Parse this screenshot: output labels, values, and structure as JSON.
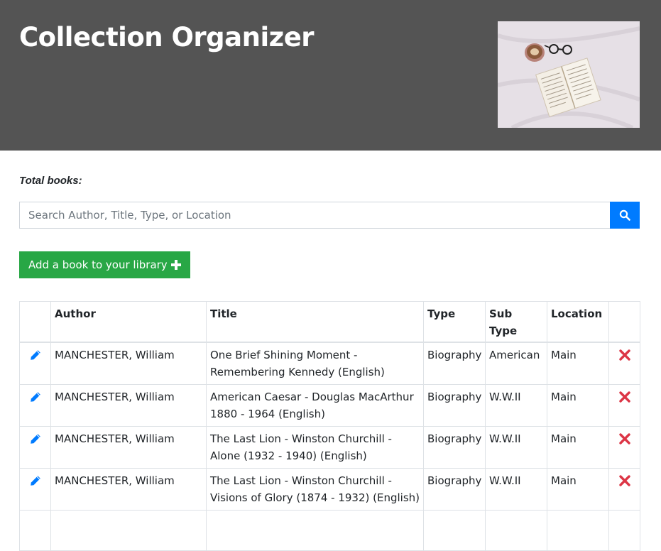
{
  "header": {
    "title": "Collection Organizer",
    "image_alt": "book-coffee-glasses-image"
  },
  "summary": {
    "total_label": "Total books:"
  },
  "search": {
    "placeholder": "Search Author, Title, Type, or Location",
    "value": ""
  },
  "actions": {
    "add_label": "Add a book to your library"
  },
  "table": {
    "headers": [
      "",
      "Author",
      "Title",
      "Type",
      "Sub Type",
      "Location",
      ""
    ],
    "rows": [
      {
        "author": "MANCHESTER, William",
        "title": "One Brief Shining Moment - Remembering Kennedy (English)",
        "type": "Biography",
        "subtype": "American",
        "location": "Main"
      },
      {
        "author": "MANCHESTER, William",
        "title": "American Caesar - Douglas MacArthur 1880 - 1964 (English)",
        "type": "Biography",
        "subtype": "W.W.II",
        "location": "Main"
      },
      {
        "author": "MANCHESTER, William",
        "title": "The Last Lion - Winston Churchill - Alone (1932 - 1940) (English)",
        "type": "Biography",
        "subtype": "W.W.II",
        "location": "Main"
      },
      {
        "author": "MANCHESTER, William",
        "title": "The Last Lion - Winston Churchill - Visions of Glory (1874 - 1932) (English)",
        "type": "Biography",
        "subtype": "W.W.II",
        "location": "Main"
      },
      {
        "author": "",
        "title": "",
        "type": "",
        "subtype": "",
        "location": ""
      }
    ]
  },
  "colors": {
    "header_bg": "#545454",
    "search_button": "#007bff",
    "add_button": "#28a745",
    "edit_icon": "#007bff",
    "delete_icon": "#dc3545"
  },
  "icons": {
    "search": "search-icon",
    "add": "plus-icon",
    "edit": "pencil-icon",
    "delete": "close-icon"
  }
}
